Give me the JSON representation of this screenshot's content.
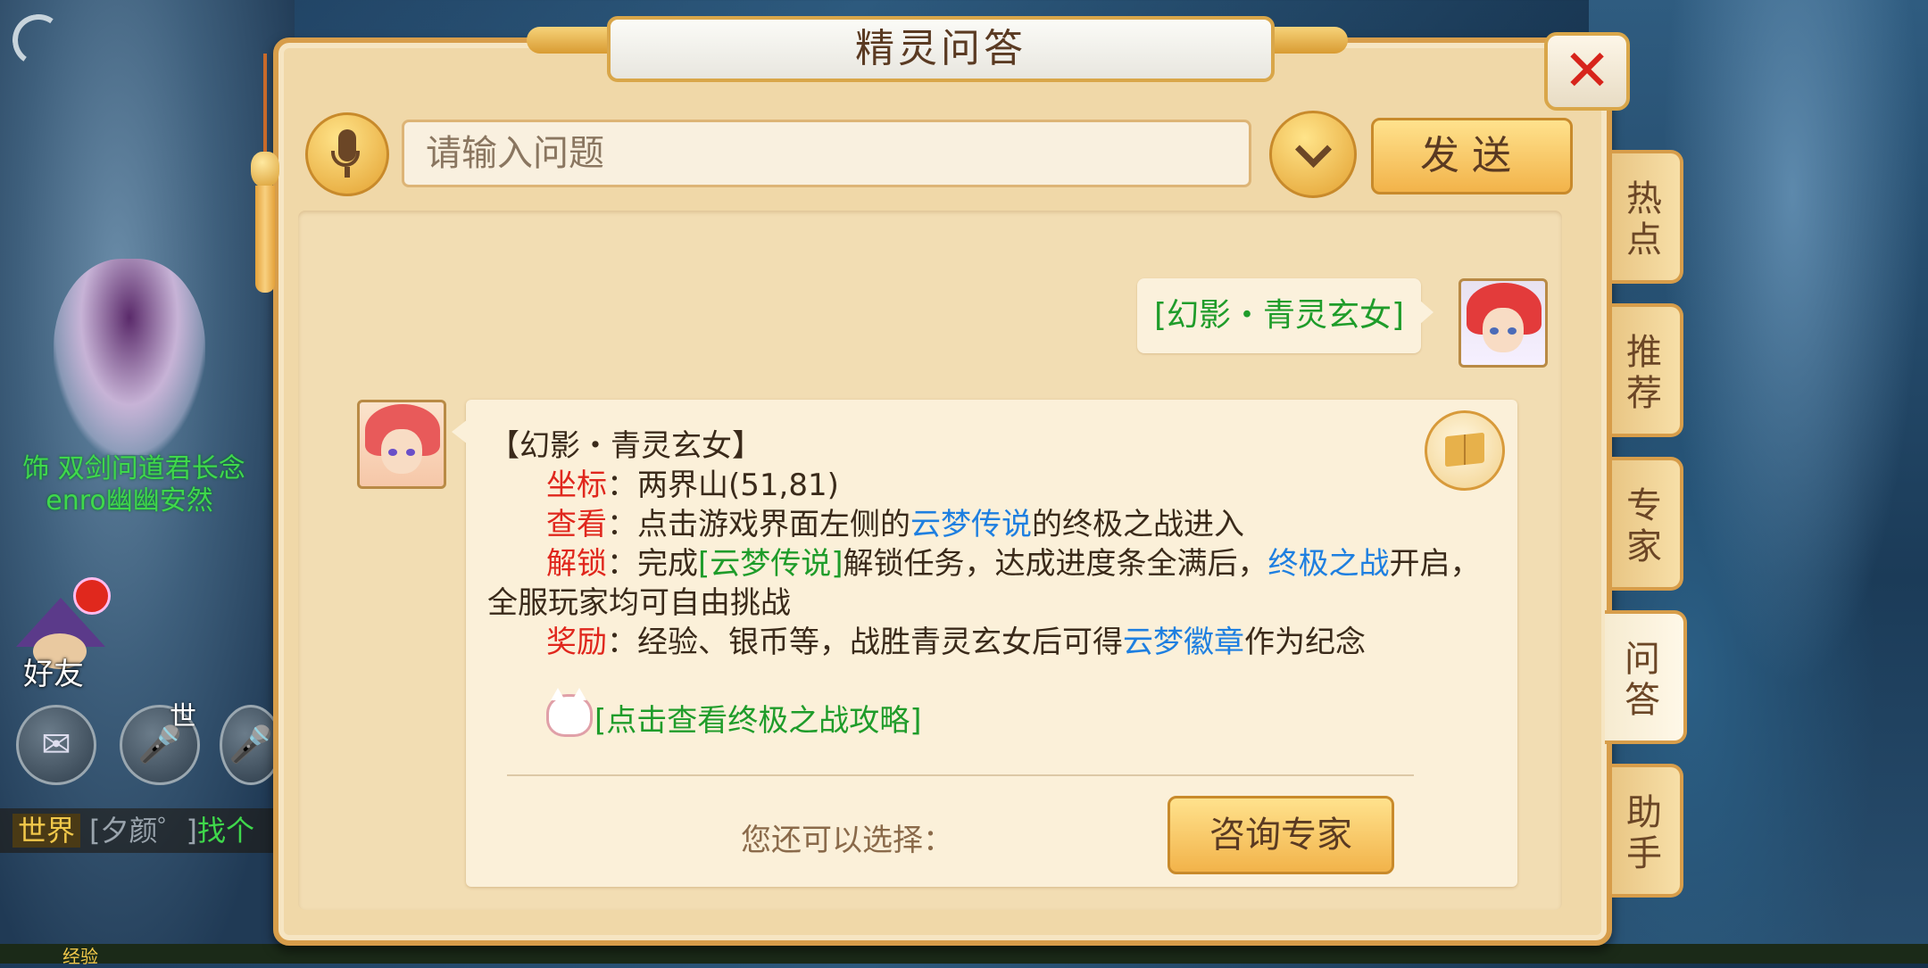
{
  "window": {
    "title": "精灵问答",
    "close_symbol": "✕"
  },
  "input": {
    "placeholder": "请输入问题",
    "value": ""
  },
  "send_button": {
    "label": "发送"
  },
  "tabs": [
    {
      "label": "热点",
      "active": false
    },
    {
      "label": "推荐",
      "active": false
    },
    {
      "label": "专家",
      "active": false
    },
    {
      "label": "问答",
      "active": true
    },
    {
      "label": "助手",
      "active": false
    }
  ],
  "user_message": "[幻影・青灵玄女]",
  "answer": {
    "title": "【幻影・青灵玄女】",
    "coord_key": "坐标",
    "coord_value": "：两界山(51,81)",
    "view_key": "查看",
    "view_pre": "：点击游戏界面左侧的",
    "view_link": "云梦传说",
    "view_post": "的终极之战进入",
    "unlock_key": "解锁",
    "unlock_pre": "：完成",
    "unlock_link": "[云梦传说]",
    "unlock_mid": "解锁任务，达成进度条全满后，",
    "unlock_link2": "终极之战",
    "unlock_post": "开启，",
    "unlock_line2": "全服玩家均可自由挑战",
    "reward_key": "奖励",
    "reward_pre": "：经验、银币等，战胜青灵玄女后可得",
    "reward_link": "云梦徽章",
    "reward_post": "作为纪念",
    "guide_link": "[点击查看终极之战攻略]"
  },
  "footer": {
    "choose_label": "您还可以选择：",
    "expert_button": "咨询专家"
  },
  "background": {
    "npc_name_line1": "饰 双剑问道君长念",
    "npc_name_line2": "enro幽幽安然",
    "friend_label": "好友",
    "world_channel_small": "世",
    "chat_channel": "世界",
    "chat_sender": "[夕颜゜]",
    "chat_text": "找个",
    "exp_label": "经验"
  },
  "colors": {
    "panel": "#f0d8a8",
    "accent": "#f2b34a",
    "key_red": "#e0271d",
    "link_blue": "#1e7fe0",
    "link_green": "#1f9c2a"
  }
}
